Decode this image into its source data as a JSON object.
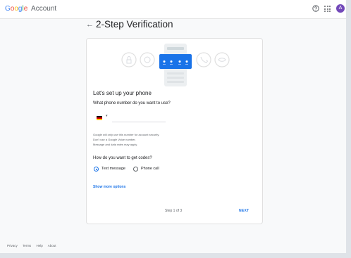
{
  "brand": {
    "g1": "G",
    "g2": "o",
    "g3": "o",
    "g4": "g",
    "g5": "l",
    "g6": "e",
    "account_label": "Account"
  },
  "header": {
    "avatar_letter": "A"
  },
  "page": {
    "back_arrow": "←",
    "title": "2-Step Verification"
  },
  "card": {
    "heading": "Let's set up your phone",
    "phone_question": "What phone number do you want to use?",
    "country_caret": "▾",
    "fine_print": [
      "Google will only use this number for account security.",
      "Don't use a Google Voice number.",
      "Message and data rates may apply."
    ],
    "codes_question": "How do you want to get codes?",
    "options": [
      {
        "label": "Text message",
        "selected": true
      },
      {
        "label": "Phone call",
        "selected": false
      }
    ],
    "show_more": "Show more options",
    "step_text": "Step 1 of 3",
    "next_label": "NEXT"
  },
  "footer": {
    "links": [
      "Privacy",
      "Terms",
      "Help",
      "About"
    ]
  },
  "colors": {
    "accent": "#1a73e8",
    "avatar": "#7248b9",
    "flag": [
      "#000000",
      "#dd0000",
      "#ffce00"
    ]
  },
  "icons": {
    "help": "help-circle-icon",
    "apps": "apps-grid-icon",
    "back": "arrow-back-icon"
  }
}
